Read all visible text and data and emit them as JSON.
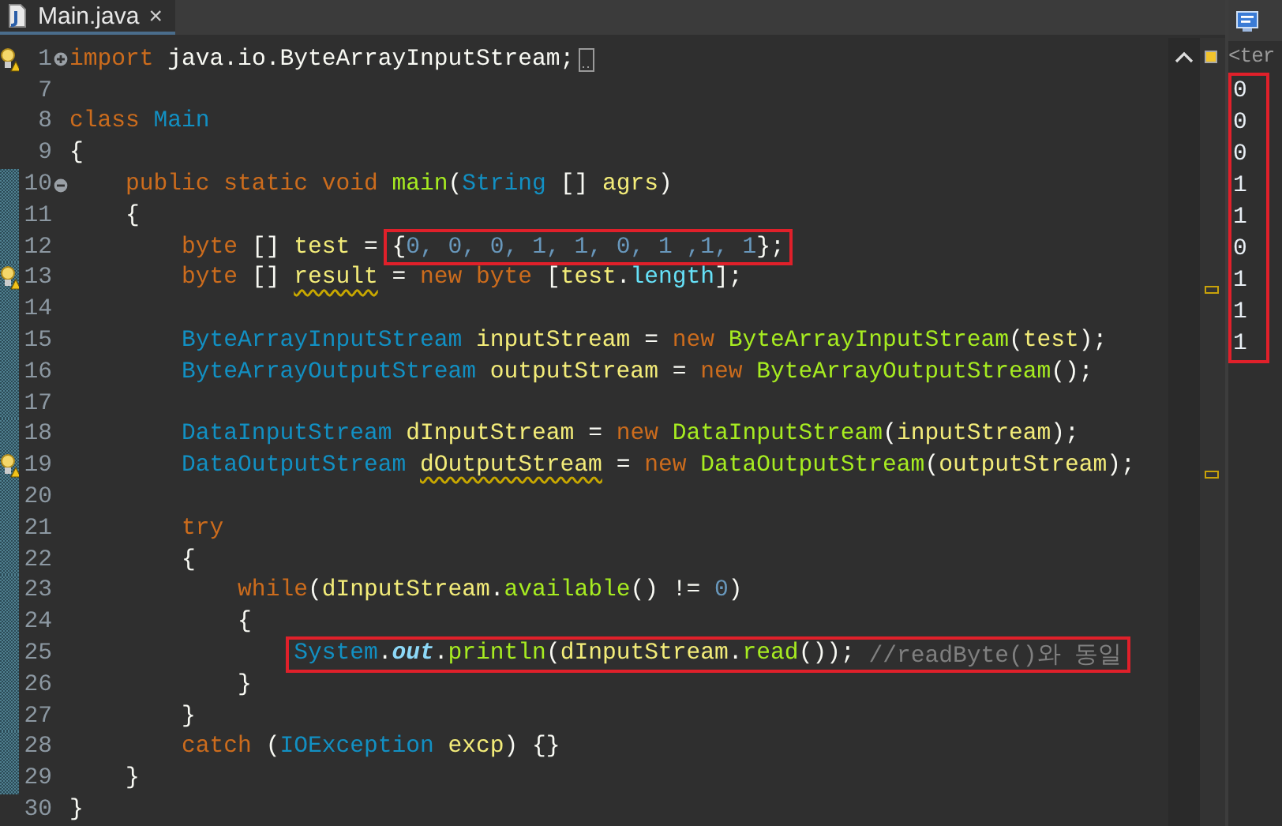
{
  "editor": {
    "tab": {
      "title": "Main.java",
      "close": "×",
      "selected": true
    },
    "lines": [
      {
        "number": "1",
        "warning": true,
        "fold": {
          "collapsed": true
        },
        "changed": false,
        "code": [
          {
            "text": "import",
            "kind": "keyword"
          },
          {
            "text": " java.io.ByteArrayInputStream;",
            "kind": "plain"
          }
        ]
      },
      {
        "number": "7",
        "warning": false,
        "changed": false
      },
      {
        "number": "8",
        "warning": false,
        "changed": false,
        "code": [
          {
            "text": "class ",
            "kind": "keyword"
          },
          {
            "text": "Main",
            "kind": "type"
          }
        ]
      },
      {
        "number": "9",
        "warning": false,
        "changed": false,
        "code": [
          {
            "text": "{",
            "kind": "plain"
          }
        ]
      },
      {
        "number": "10",
        "warning": false,
        "fold": {
          "collapsed": false
        },
        "changed": true,
        "code": [
          {
            "text": "    public static void ",
            "kind": "keyword"
          },
          {
            "text": "main",
            "kind": "method"
          },
          {
            "text": "(",
            "kind": "plain"
          },
          {
            "text": "String",
            "kind": "type"
          },
          {
            "text": " [] ",
            "kind": "plain"
          },
          {
            "text": "agrs",
            "kind": "variable"
          },
          {
            "text": ")",
            "kind": "plain"
          }
        ]
      },
      {
        "number": "11",
        "warning": false,
        "changed": true,
        "code": [
          {
            "text": "    {",
            "kind": "plain"
          }
        ]
      },
      {
        "number": "12",
        "warning": false,
        "changed": true,
        "code": [
          {
            "text": "        byte",
            "kind": "keyword"
          },
          {
            "text": " [] ",
            "kind": "plain"
          },
          {
            "text": "test",
            "kind": "variable"
          },
          {
            "text": " = ",
            "kind": "plain"
          }
        ],
        "boxed": [
          {
            "text": "{",
            "kind": "plain"
          },
          {
            "text": "0, 0, 0, 1, 1, 0, 1 ,1, 1",
            "kind": "number"
          },
          {
            "text": "};",
            "kind": "plain"
          }
        ]
      },
      {
        "number": "13",
        "warning": true,
        "changed": true,
        "code": [
          {
            "text": "        byte",
            "kind": "keyword"
          },
          {
            "text": " [] ",
            "kind": "plain"
          },
          {
            "text": "result",
            "kind": "unused"
          },
          {
            "text": " = ",
            "kind": "plain"
          },
          {
            "text": "new byte",
            "kind": "keyword"
          },
          {
            "text": " [",
            "kind": "plain"
          },
          {
            "text": "test",
            "kind": "variable"
          },
          {
            "text": ".",
            "kind": "plain"
          },
          {
            "text": "length",
            "kind": "field"
          },
          {
            "text": "];",
            "kind": "plain"
          }
        ]
      },
      {
        "number": "14",
        "warning": false,
        "changed": true
      },
      {
        "number": "15",
        "warning": false,
        "changed": true,
        "code": [
          {
            "text": "        ByteArrayInputStream ",
            "kind": "type"
          },
          {
            "text": "inputStream",
            "kind": "variable"
          },
          {
            "text": " = ",
            "kind": "plain"
          },
          {
            "text": "new ",
            "kind": "keyword"
          },
          {
            "text": "ByteArrayInputStream",
            "kind": "method"
          },
          {
            "text": "(",
            "kind": "plain"
          },
          {
            "text": "test",
            "kind": "variable"
          },
          {
            "text": ");",
            "kind": "plain"
          }
        ]
      },
      {
        "number": "16",
        "warning": false,
        "changed": true,
        "code": [
          {
            "text": "        ByteArrayOutputStream ",
            "kind": "type"
          },
          {
            "text": "outputStream",
            "kind": "variable"
          },
          {
            "text": " = ",
            "kind": "plain"
          },
          {
            "text": "new ",
            "kind": "keyword"
          },
          {
            "text": "ByteArrayOutputStream",
            "kind": "method"
          },
          {
            "text": "();",
            "kind": "plain"
          }
        ]
      },
      {
        "number": "17",
        "warning": false,
        "changed": true
      },
      {
        "number": "18",
        "warning": false,
        "changed": true,
        "code": [
          {
            "text": "        DataInputStream ",
            "kind": "type"
          },
          {
            "text": "dInputStream",
            "kind": "variable"
          },
          {
            "text": " = ",
            "kind": "plain"
          },
          {
            "text": "new ",
            "kind": "keyword"
          },
          {
            "text": "DataInputStream",
            "kind": "method"
          },
          {
            "text": "(",
            "kind": "plain"
          },
          {
            "text": "inputStream",
            "kind": "variable"
          },
          {
            "text": ");",
            "kind": "plain"
          }
        ]
      },
      {
        "number": "19",
        "warning": true,
        "changed": true,
        "code": [
          {
            "text": "        DataOutputStream ",
            "kind": "type"
          },
          {
            "text": "dOutputStream",
            "kind": "unused"
          },
          {
            "text": " = ",
            "kind": "plain"
          },
          {
            "text": "new ",
            "kind": "keyword"
          },
          {
            "text": "DataOutputStream",
            "kind": "method"
          },
          {
            "text": "(",
            "kind": "plain"
          },
          {
            "text": "outputStream",
            "kind": "variable"
          },
          {
            "text": ");",
            "kind": "plain"
          }
        ]
      },
      {
        "number": "20",
        "warning": false,
        "changed": true
      },
      {
        "number": "21",
        "warning": false,
        "changed": true,
        "code": [
          {
            "text": "        try",
            "kind": "keyword"
          }
        ]
      },
      {
        "number": "22",
        "warning": false,
        "changed": true,
        "code": [
          {
            "text": "        {",
            "kind": "plain"
          }
        ]
      },
      {
        "number": "23",
        "warning": false,
        "changed": true,
        "code": [
          {
            "text": "            while",
            "kind": "keyword"
          },
          {
            "text": "(",
            "kind": "plain"
          },
          {
            "text": "dInputStream",
            "kind": "variable"
          },
          {
            "text": ".",
            "kind": "plain"
          },
          {
            "text": "available",
            "kind": "method"
          },
          {
            "text": "() != ",
            "kind": "plain"
          },
          {
            "text": "0",
            "kind": "number"
          },
          {
            "text": ")",
            "kind": "plain"
          }
        ]
      },
      {
        "number": "24",
        "warning": false,
        "changed": true,
        "code": [
          {
            "text": "            {",
            "kind": "plain"
          }
        ]
      },
      {
        "number": "25",
        "warning": false,
        "changed": true,
        "boxed": [
          {
            "text": "                System",
            "kind": "type"
          },
          {
            "text": ".",
            "kind": "plain"
          },
          {
            "text": "out",
            "kind": "static"
          },
          {
            "text": ".",
            "kind": "plain"
          },
          {
            "text": "println",
            "kind": "method"
          },
          {
            "text": "(",
            "kind": "plain"
          },
          {
            "text": "dInputStream",
            "kind": "variable"
          },
          {
            "text": ".",
            "kind": "plain"
          },
          {
            "text": "read",
            "kind": "method"
          },
          {
            "text": "());",
            "kind": "plain"
          },
          {
            "text": " //readByte()와 동일",
            "kind": "comment"
          }
        ]
      },
      {
        "number": "26",
        "warning": false,
        "changed": true,
        "code": [
          {
            "text": "            }",
            "kind": "plain"
          }
        ]
      },
      {
        "number": "27",
        "warning": false,
        "changed": true,
        "code": [
          {
            "text": "        }",
            "kind": "plain"
          }
        ]
      },
      {
        "number": "28",
        "warning": false,
        "changed": true,
        "code": [
          {
            "text": "        catch",
            "kind": "keyword"
          },
          {
            "text": " (",
            "kind": "plain"
          },
          {
            "text": "IOException",
            "kind": "type"
          },
          {
            "text": " excp",
            "kind": "variable"
          },
          {
            "text": ") {}",
            "kind": "plain"
          }
        ]
      },
      {
        "number": "29",
        "warning": false,
        "changed": true,
        "code": [
          {
            "text": "    }",
            "kind": "plain"
          }
        ]
      },
      {
        "number": "30",
        "warning": false,
        "changed": false,
        "code": [
          {
            "text": "}",
            "kind": "plain"
          }
        ]
      }
    ]
  },
  "console": {
    "header": "<ter",
    "output": [
      "0",
      "0",
      "0",
      "1",
      "1",
      "0",
      "1",
      "1",
      "1"
    ]
  }
}
